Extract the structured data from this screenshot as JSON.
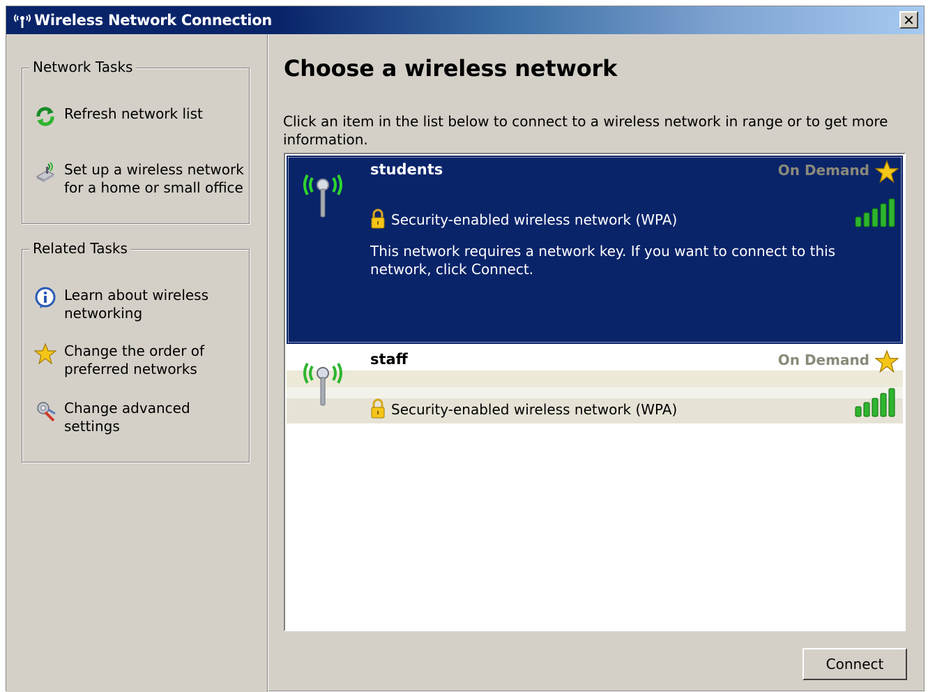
{
  "window": {
    "title": "Wireless Network Connection",
    "close_label": "✕"
  },
  "colors": {
    "titlebar_start": "#0a246a",
    "titlebar_end": "#a6caf0",
    "selection": "#0a246a",
    "signal_green": "#2fb52f",
    "on_demand_text": "#8a8a7a"
  },
  "sidebar": {
    "network_tasks": {
      "title": "Network Tasks",
      "items": [
        {
          "label": "Refresh network list",
          "icon": "refresh-icon"
        },
        {
          "label": "Set up a wireless network for a home or small office",
          "icon": "wireless-setup-icon"
        }
      ]
    },
    "related_tasks": {
      "title": "Related Tasks",
      "items": [
        {
          "label": "Learn about wireless networking",
          "icon": "info-icon"
        },
        {
          "label": "Change the order of preferred networks",
          "icon": "star-icon"
        },
        {
          "label": "Change advanced settings",
          "icon": "settings-icon"
        }
      ]
    }
  },
  "main": {
    "heading": "Choose a wireless network",
    "instructions": "Click an item in the list below to connect to a wireless network in range or to get more information.",
    "networks": [
      {
        "ssid": "students",
        "mode": "On Demand",
        "security": "Security-enabled wireless network (WPA)",
        "description": "This network requires a network key. If you want to connect to this network, click Connect.",
        "selected": true,
        "signal_bars": 5
      },
      {
        "ssid": "staff",
        "mode": "On Demand",
        "security": "Security-enabled wireless network (WPA)",
        "selected": false,
        "signal_bars": 5
      }
    ],
    "connect_label": "Connect"
  }
}
